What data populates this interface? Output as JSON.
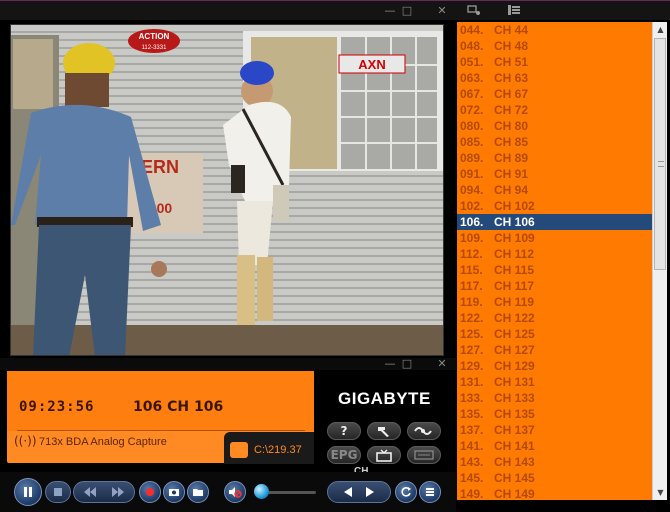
{
  "window_controls": {
    "minimize": "—",
    "restore": "□",
    "close": "✕"
  },
  "panel_controls": {
    "minimize": "—",
    "restore": "□",
    "close": "✕"
  },
  "video": {
    "sign_top": "ACTION",
    "sign_top_sub": "112-3331",
    "logo": "AXN",
    "sign_left": "ERN",
    "sign_left_sub": "0900"
  },
  "channels": [
    {
      "num": "044.",
      "name": "CH 44"
    },
    {
      "num": "048.",
      "name": "CH 48"
    },
    {
      "num": "051.",
      "name": "CH 51"
    },
    {
      "num": "063.",
      "name": "CH 63"
    },
    {
      "num": "067.",
      "name": "CH 67"
    },
    {
      "num": "072.",
      "name": "CH 72"
    },
    {
      "num": "080.",
      "name": "CH 80"
    },
    {
      "num": "085.",
      "name": "CH 85"
    },
    {
      "num": "089.",
      "name": "CH 89"
    },
    {
      "num": "091.",
      "name": "CH 91"
    },
    {
      "num": "094.",
      "name": "CH 94"
    },
    {
      "num": "102.",
      "name": "CH 102"
    },
    {
      "num": "106.",
      "name": "CH 106"
    },
    {
      "num": "109.",
      "name": "CH 109"
    },
    {
      "num": "112.",
      "name": "CH 112"
    },
    {
      "num": "115.",
      "name": "CH 115"
    },
    {
      "num": "117.",
      "name": "CH 117"
    },
    {
      "num": "119.",
      "name": "CH 119"
    },
    {
      "num": "122.",
      "name": "CH 122"
    },
    {
      "num": "125.",
      "name": "CH 125"
    },
    {
      "num": "127.",
      "name": "CH 127"
    },
    {
      "num": "129.",
      "name": "CH 129"
    },
    {
      "num": "131.",
      "name": "CH 131"
    },
    {
      "num": "133.",
      "name": "CH 133"
    },
    {
      "num": "135.",
      "name": "CH 135"
    },
    {
      "num": "137.",
      "name": "CH 137"
    },
    {
      "num": "141.",
      "name": "CH 141"
    },
    {
      "num": "143.",
      "name": "CH 143"
    },
    {
      "num": "145.",
      "name": "CH 145"
    },
    {
      "num": "149.",
      "name": "CH 149"
    }
  ],
  "selected_channel": "106.",
  "lcd": {
    "time": "09:23:56",
    "channel": "106 CH 106",
    "source": "713x BDA Analog Capture",
    "disk": "C:\\219.37"
  },
  "brand": "GIGABYTE",
  "buttons": {
    "help": "?",
    "epg": "EPG",
    "ch_label": "CH"
  },
  "colors": {
    "accent_orange": "#ff7a00",
    "selected_row": "#244a7c",
    "button_blue": "#1d3a66"
  }
}
